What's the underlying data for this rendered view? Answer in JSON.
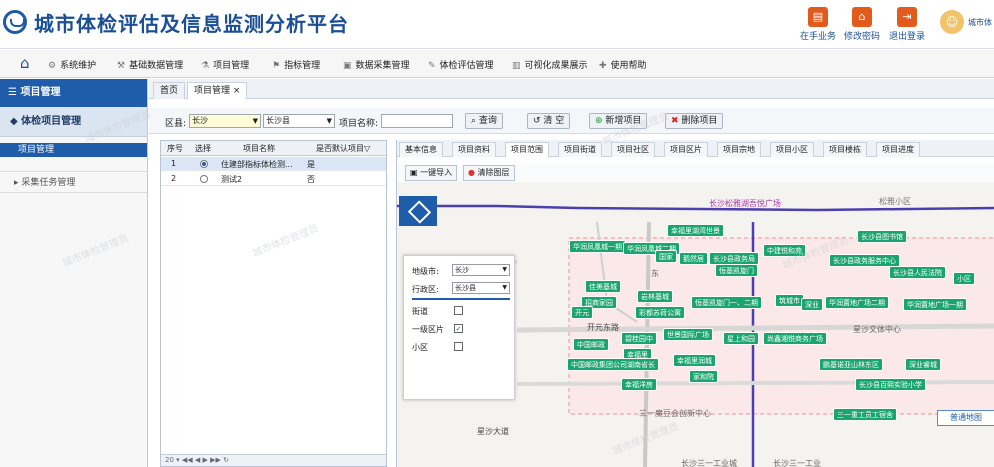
{
  "header": {
    "title": "城市体检评估及信息监测分析平台",
    "buttons": [
      {
        "label": "在手业务",
        "icon": "briefcase-icon"
      },
      {
        "label": "修改密码",
        "icon": "lock-icon"
      },
      {
        "label": "退出登录",
        "icon": "logout-icon"
      }
    ],
    "username": "城市体"
  },
  "menu": {
    "items": [
      "系统维护",
      "基础数据管理",
      "项目管理",
      "指标管理",
      "数据采集管理",
      "体检评估管理",
      "可视化成果展示",
      "使用帮助"
    ]
  },
  "sidebar": {
    "header": "项目管理",
    "group": "体检项目管理",
    "selected": "项目管理",
    "other": "采集任务管理"
  },
  "tabs": {
    "home": "首页",
    "active": "项目管理",
    "close": "×"
  },
  "filter": {
    "district_label": "区县:",
    "city_value": "长沙",
    "county_value": "长沙县",
    "name_label": "项目名称:",
    "name_value": "",
    "query": "查询",
    "clear": "清 空",
    "add": "新增项目",
    "delete": "删除项目"
  },
  "grid": {
    "headers": [
      "序号",
      "选择",
      "项目名称",
      "是否默认项目"
    ],
    "rows": [
      {
        "no": "1",
        "selected": true,
        "name": "住建部指标体检测...",
        "default": "是"
      },
      {
        "no": "2",
        "selected": false,
        "name": "测试2",
        "default": "否"
      }
    ],
    "pager": "20"
  },
  "subtabs": [
    "基本信息",
    "项目资料",
    "项目范围",
    "项目街道",
    "项目社区",
    "项目区片",
    "项目宗地",
    "项目小区",
    "项目楼栋",
    "项目进度"
  ],
  "subtabs_active": "项目范围",
  "maptools": {
    "import": "一键导入",
    "clear": "清除图层"
  },
  "layer_panel": {
    "city_label": "地级市:",
    "city_value": "长沙",
    "district_label": "行政区:",
    "district_value": "长沙县",
    "street_label": "街道",
    "street_checked": false,
    "zone_label": "一级区片",
    "zone_checked": true,
    "community_label": "小区",
    "community_checked": false
  },
  "map_labels": [
    "长沙松雅湖吾悦广场",
    "松雅小区",
    "东",
    "开元东路",
    "星沙文体中心",
    "三一魔豆会创新中心",
    "星沙大道",
    "长沙三一工业城",
    "长沙三一工业"
  ],
  "map_pins": [
    "幸福里湖湾世景",
    "长沙县图书馆",
    "华润凤凰城一期",
    "华润凤凰城二期",
    "中建悦和苑",
    "长沙县政务服务中心",
    "国家",
    "鹅然居",
    "长沙县政务局",
    "长沙县人民法院",
    "小区",
    "恒基凯旋门",
    "佳美基城",
    "招商家园",
    "岩林基城",
    "恒基凯旋门一、二期",
    "筑城市",
    "深业",
    "华润置地广场二期",
    "华润置地广场一期",
    "开元",
    "彩都苏荷公寓",
    "世景国际广场",
    "星上和园",
    "尚鑫湘悦商务广场",
    "中国邮政",
    "碧桂园中",
    "幸福里",
    "中国邮政集团公司湖南省长",
    "幸福里润城",
    "鹏基诺亚山林东区",
    "深业睿城",
    "家和院",
    "长沙县百熙实验小学",
    "幸福洋房",
    "三一重工员工宿舍"
  ],
  "basemap_button": "普通地图",
  "watermark": "城市体检管理员",
  "colors": {
    "primary": "#1f5ca9",
    "accent": "#e25b1c",
    "pin": "#1aa46e",
    "road": "#4b3fb0"
  }
}
